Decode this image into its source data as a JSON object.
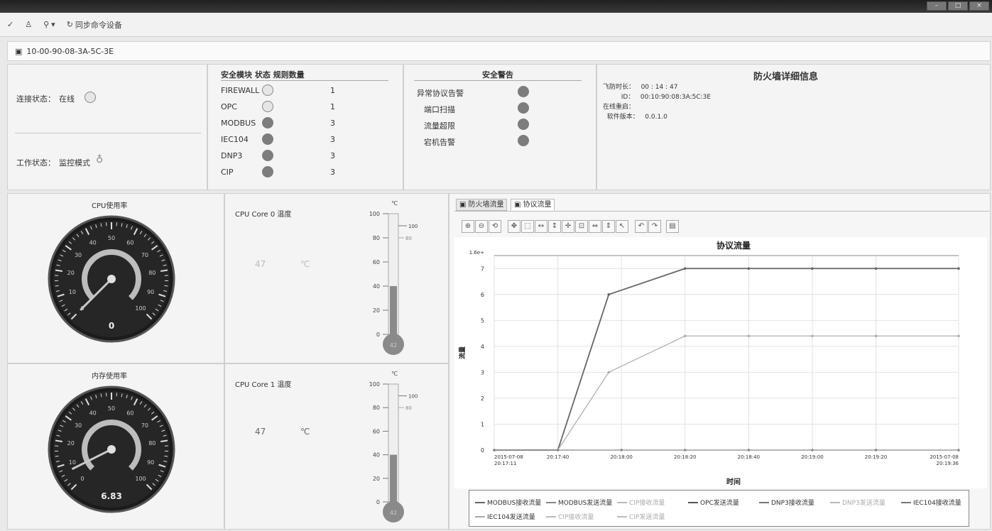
{
  "toolbar": {
    "sync_label": "同步命令设备"
  },
  "device": {
    "id": "10-00-90-08-3A-5C-3E"
  },
  "status": {
    "link_label": "连接状态：",
    "link_value": "在线",
    "work_label": "工作状态：",
    "work_value": "监控模式"
  },
  "protocol": {
    "header": "安全模块  状态  规则数量",
    "rows": [
      {
        "name": "FIREWALL",
        "state": "hollow",
        "count": "1"
      },
      {
        "name": "OPC",
        "state": "hollow",
        "count": "1"
      },
      {
        "name": "MODBUS",
        "state": "filled",
        "count": "3"
      },
      {
        "name": "IEC104",
        "state": "filled",
        "count": "3"
      },
      {
        "name": "DNP3",
        "state": "filled",
        "count": "3"
      },
      {
        "name": "CIP",
        "state": "filled",
        "count": "3"
      }
    ]
  },
  "alarms": {
    "header": "安全警告",
    "rows": [
      {
        "name": "异常协议告警"
      },
      {
        "name": "端口扫描"
      },
      {
        "name": "流量超限"
      },
      {
        "name": "宕机告警"
      }
    ]
  },
  "detail": {
    "title": "防火墙详细信息",
    "lines": [
      "飞防时长：   00 : 14 : 47",
      "         ID：   00:10:90:08:3A:5C:3E",
      "在线重启：",
      "  软件版本：   0.0.1.0"
    ]
  },
  "gauges": {
    "cpu": {
      "title": "CPU使用率",
      "value": "0",
      "pct": 0
    },
    "mem": {
      "title": "内存使用率",
      "value": "6.83",
      "pct": 6.83
    },
    "ticks": [
      "0",
      "10",
      "20",
      "30",
      "40",
      "50",
      "60",
      "70",
      "80",
      "90",
      "100"
    ]
  },
  "temps": {
    "core0": {
      "title": "CPU Core 0 温度",
      "value": "47",
      "unit": "℃",
      "fill": 40,
      "badge": "42"
    },
    "core1": {
      "title": "CPU Core 1 温度",
      "value": "47",
      "unit": "℃",
      "fill": 40,
      "badge": "42"
    },
    "unit": "℃",
    "ticks": [
      "100",
      "80",
      "60",
      "40",
      "20",
      "0"
    ],
    "mark_high": "100",
    "mark_low": "80"
  },
  "tabs": {
    "tab1": "防火墙流量",
    "tab2": "协议流量"
  },
  "chart_data": {
    "type": "line",
    "title": "协议流量",
    "xlabel": "时间",
    "ylabel": "流量",
    "y_top_label": "1.6e+",
    "yticks": [
      "7",
      "6",
      "5",
      "4",
      "3",
      "2",
      "1",
      "0"
    ],
    "xticks": [
      [
        "2015-07-08",
        "20:17:11"
      ],
      [
        "20:17:40",
        ""
      ],
      [
        "20:18:00",
        ""
      ],
      [
        "20:18:20",
        ""
      ],
      [
        "20:18:40",
        ""
      ],
      [
        "20:19:00",
        ""
      ],
      [
        "20:19:20",
        ""
      ],
      [
        "2015-07-08",
        "20:19:36"
      ]
    ],
    "ylim": [
      0,
      7.5
    ],
    "series": [
      {
        "name": "MODBUS接收流量",
        "color": "#666666",
        "values": [
          [
            0,
            0
          ],
          [
            1,
            0
          ],
          [
            1.8,
            6
          ],
          [
            3,
            7
          ],
          [
            4,
            7
          ],
          [
            5,
            7
          ],
          [
            6,
            7
          ],
          [
            7.3,
            7
          ]
        ]
      },
      {
        "name": "OPC发送流量",
        "color": "#b0b0b0",
        "values": [
          [
            0,
            0
          ],
          [
            1,
            0
          ],
          [
            1.8,
            3
          ],
          [
            3,
            4.4
          ],
          [
            4,
            4.4
          ],
          [
            5,
            4.4
          ],
          [
            6,
            4.4
          ],
          [
            7.3,
            4.4
          ]
        ]
      },
      {
        "name": "IEC104接收流量",
        "color": "#888888",
        "values": [
          [
            0,
            0
          ],
          [
            1,
            0
          ],
          [
            2,
            0
          ],
          [
            3,
            0
          ],
          [
            4,
            0
          ],
          [
            5,
            0
          ],
          [
            6,
            0
          ],
          [
            7.3,
            0
          ]
        ]
      }
    ],
    "legend": [
      "MODBUS接收流量",
      "MODBUS发送流量",
      "CIP接收流量",
      "OPC发送流量",
      "DNP3接收流量",
      "DNP3发送流量",
      "IEC104接收流量",
      "IEC104发送流量",
      "CIP接收流量",
      "CIP发送流量"
    ]
  }
}
